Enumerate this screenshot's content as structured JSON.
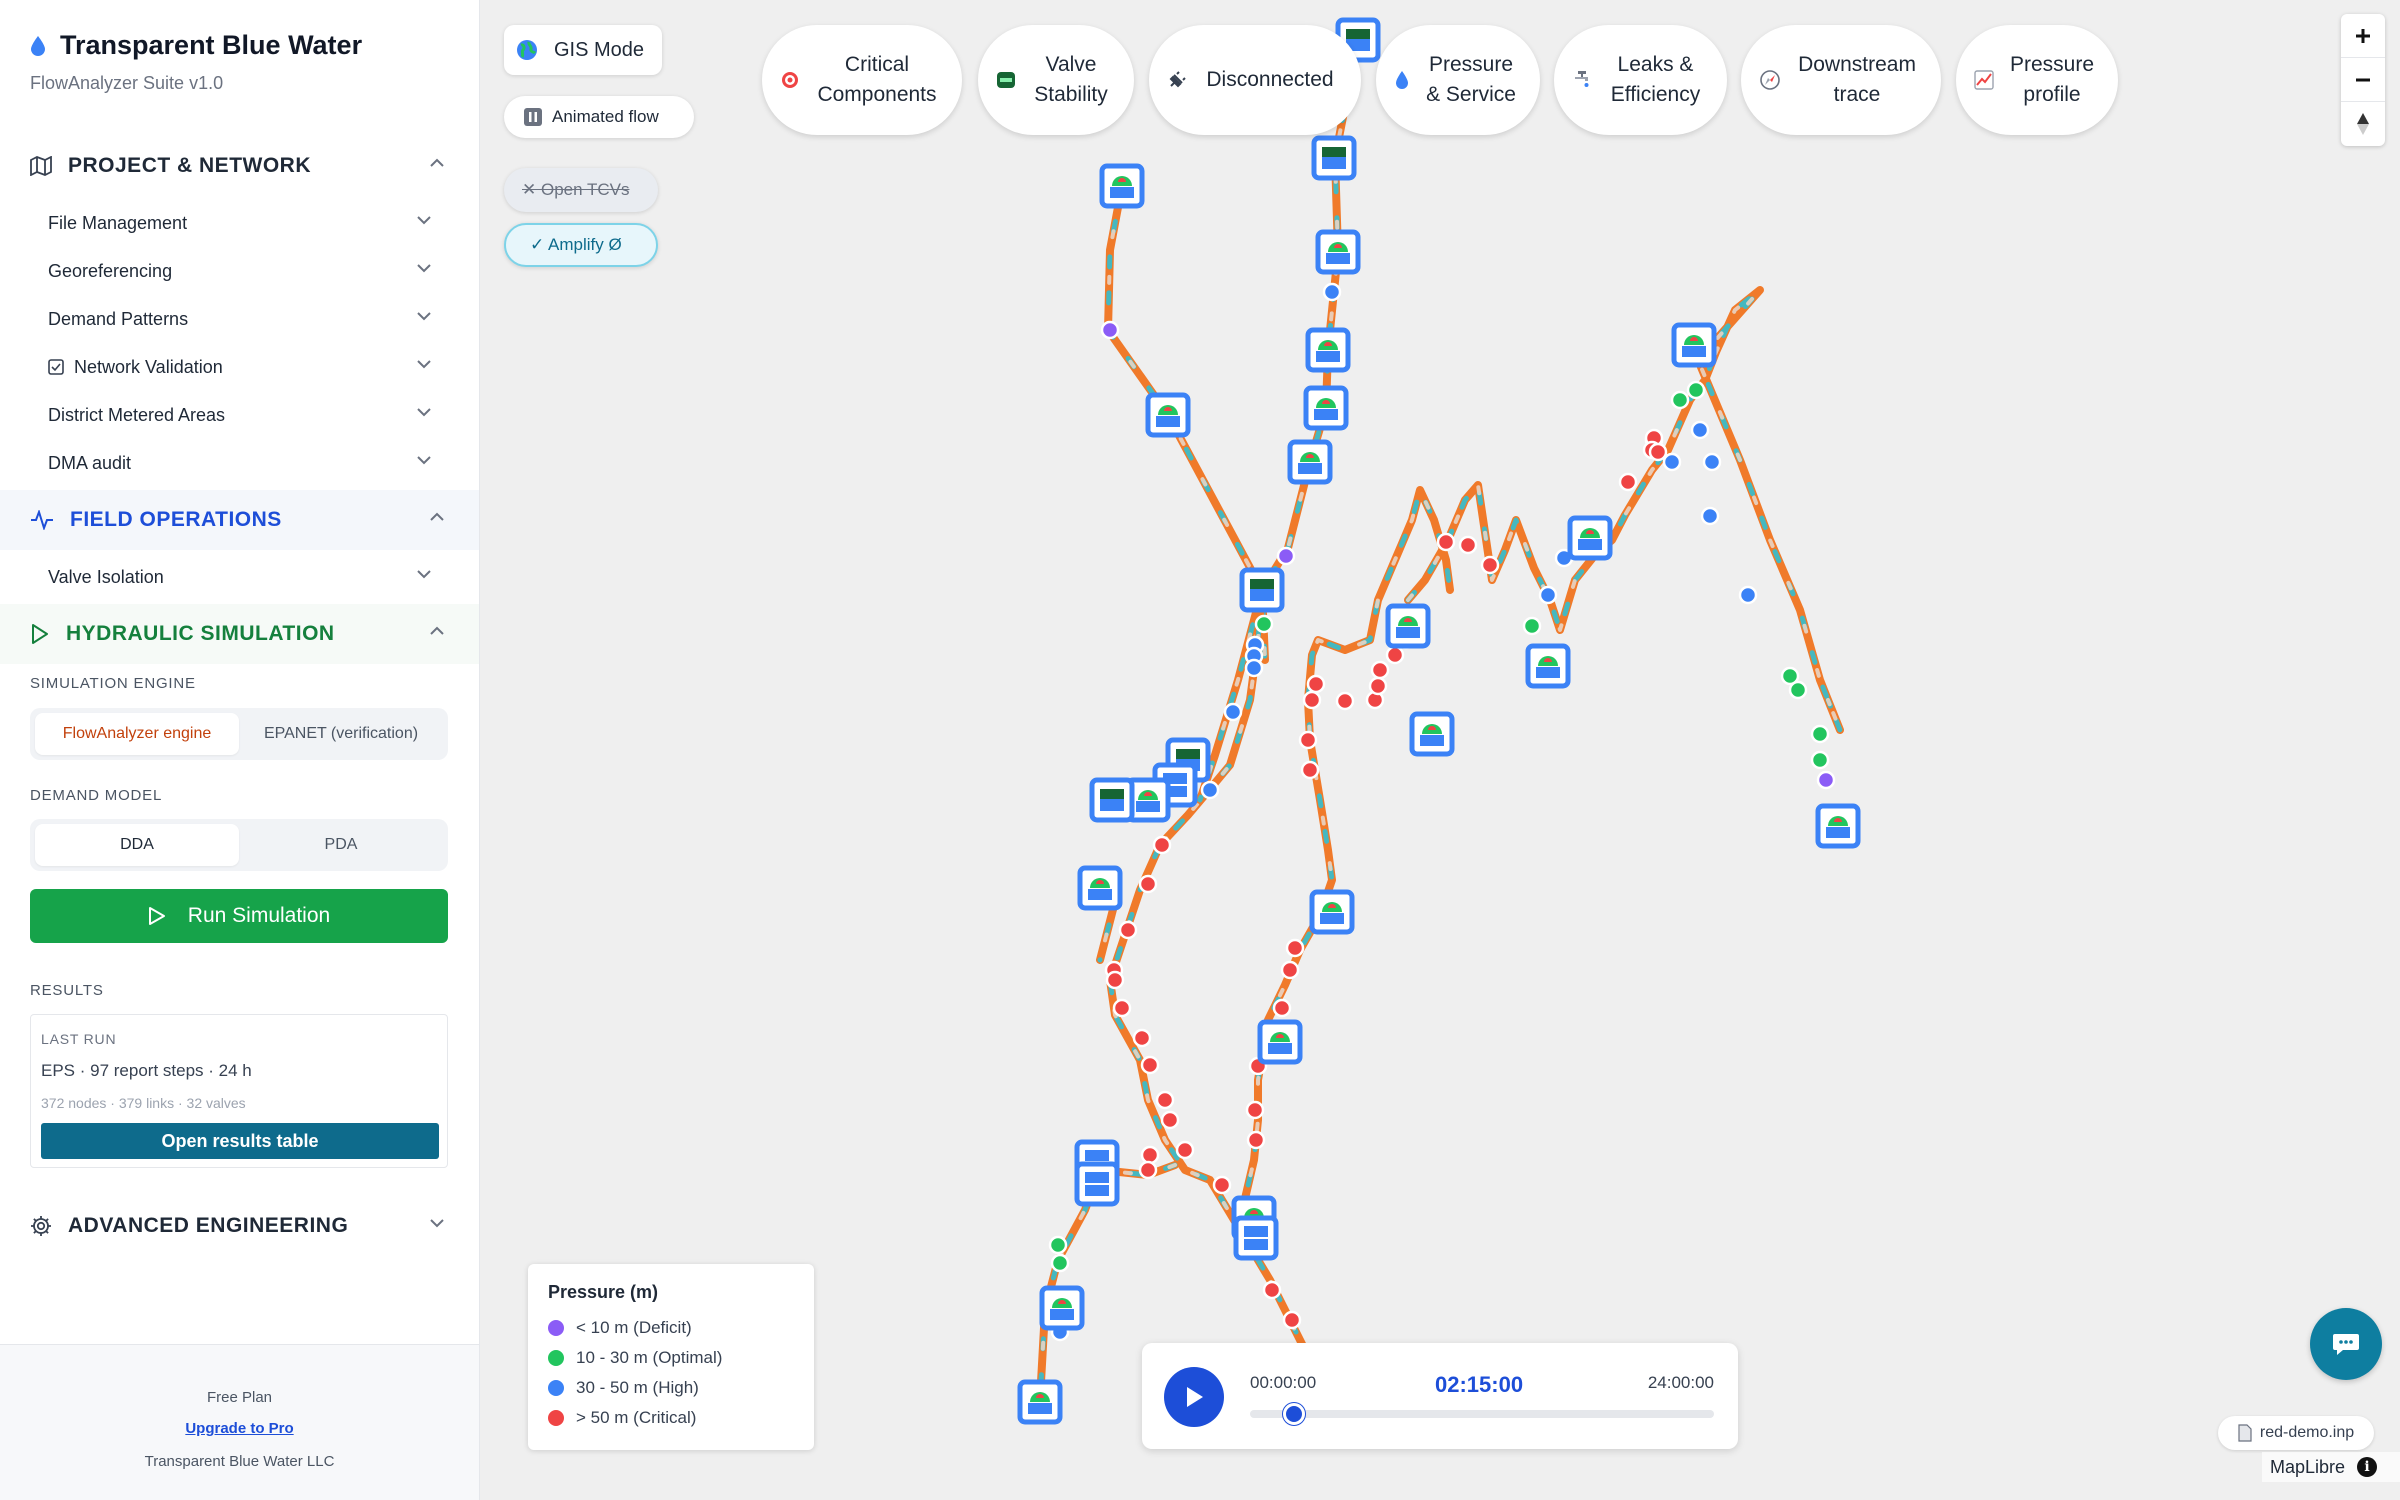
{
  "app": {
    "title": "Transparent Blue Water",
    "subtitle": "FlowAnalyzer Suite v1.0"
  },
  "sections": {
    "project": {
      "label": "PROJECT & NETWORK",
      "items": [
        "File Management",
        "Georeferencing",
        "Demand Patterns",
        "Network Validation",
        "District Metered Areas",
        "DMA audit"
      ]
    },
    "field": {
      "label": "FIELD OPERATIONS",
      "items": [
        "Valve Isolation"
      ]
    },
    "hydro": {
      "label": "HYDRAULIC SIMULATION"
    },
    "advanced": {
      "label": "ADVANCED ENGINEERING"
    }
  },
  "simulation": {
    "engine_label": "SIMULATION ENGINE",
    "engines": [
      "FlowAnalyzer engine",
      "EPANET (verification)"
    ],
    "demand_label": "DEMAND MODEL",
    "demand_models": [
      "DDA",
      "PDA"
    ],
    "run_label": "Run Simulation"
  },
  "results": {
    "label": "RESULTS",
    "last_run_label": "LAST RUN",
    "summary": "EPS · 97 report steps · 24 h",
    "stats": "372 nodes · 379 links · 32 valves",
    "open_table": "Open results table"
  },
  "footer": {
    "plan": "Free Plan",
    "upgrade": "Upgrade to Pro",
    "company": "Transparent Blue Water LLC"
  },
  "map_controls": {
    "gis_mode": "GIS Mode",
    "animated_flow": "Animated flow",
    "open_tcvs": "✕ Open TCVs",
    "amplify": "✓ Amplify Ø"
  },
  "pills": [
    {
      "label": "Critical Components",
      "icon": "target-icon"
    },
    {
      "label": "Valve Stability",
      "icon": "stability-icon"
    },
    {
      "label": "Disconnected",
      "icon": "plug-icon"
    },
    {
      "label": "Pressure & Service",
      "icon": "drop-icon"
    },
    {
      "label": "Leaks & Efficiency",
      "icon": "faucet-icon"
    },
    {
      "label": "Downstream trace",
      "icon": "compass-icon"
    },
    {
      "label": "Pressure profile",
      "icon": "chart-icon"
    }
  ],
  "legend": {
    "title": "Pressure (m)",
    "entries": [
      {
        "label": "< 10 m (Deficit)",
        "color": "#8b5cf6"
      },
      {
        "label": "10 - 30 m (Optimal)",
        "color": "#22c55e"
      },
      {
        "label": "30 - 50 m (High)",
        "color": "#3b82f6"
      },
      {
        "label": "> 50 m (Critical)",
        "color": "#ef4444"
      }
    ]
  },
  "timeline": {
    "start": "00:00:00",
    "current": "02:15:00",
    "end": "24:00:00",
    "progress": 0.094
  },
  "file_name": "red-demo.inp",
  "attribution": "MapLibre",
  "colors": {
    "pipe": "#f07a2a",
    "flow": "#3bbcc8",
    "tank": "#3b82f6",
    "primary": "#1d4ed8",
    "success": "#16a34a",
    "teal": "#0e6b8c"
  }
}
